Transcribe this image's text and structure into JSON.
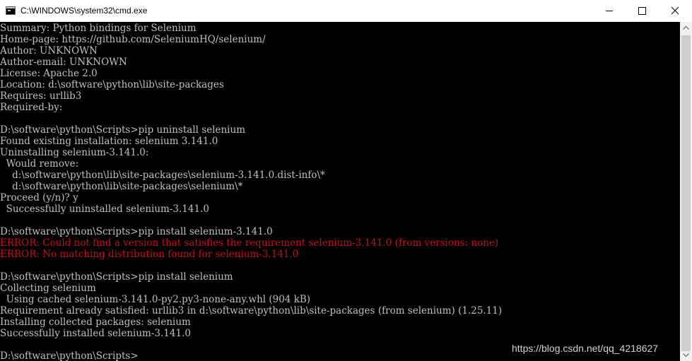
{
  "window": {
    "title": "C:\\WINDOWS\\system32\\cmd.exe",
    "icon": "console-icon",
    "controls": {
      "minimize": "minimize-icon",
      "maximize": "maximize-icon",
      "close": "close-icon"
    }
  },
  "console": {
    "text_color": "#c0c0c0",
    "error_color": "#c50f1f",
    "background": "#000000",
    "lines": [
      {
        "text": "Summary: Python bindings for Selenium",
        "type": "normal"
      },
      {
        "text": "Home-page: https://github.com/SeleniumHQ/selenium/",
        "type": "normal"
      },
      {
        "text": "Author: UNKNOWN",
        "type": "normal"
      },
      {
        "text": "Author-email: UNKNOWN",
        "type": "normal"
      },
      {
        "text": "License: Apache 2.0",
        "type": "normal"
      },
      {
        "text": "Location: d:\\software\\python\\lib\\site-packages",
        "type": "normal"
      },
      {
        "text": "Requires: urllib3",
        "type": "normal"
      },
      {
        "text": "Required-by:",
        "type": "normal"
      },
      {
        "text": "",
        "type": "normal"
      },
      {
        "text": "D:\\software\\python\\Scripts>pip uninstall selenium",
        "type": "normal"
      },
      {
        "text": "Found existing installation: selenium 3.141.0",
        "type": "normal"
      },
      {
        "text": "Uninstalling selenium-3.141.0:",
        "type": "normal"
      },
      {
        "text": "  Would remove:",
        "type": "normal"
      },
      {
        "text": "    d:\\software\\python\\lib\\site-packages\\selenium-3.141.0.dist-info\\*",
        "type": "normal"
      },
      {
        "text": "    d:\\software\\python\\lib\\site-packages\\selenium\\*",
        "type": "normal"
      },
      {
        "text": "Proceed (y/n)? y",
        "type": "normal"
      },
      {
        "text": "  Successfully uninstalled selenium-3.141.0",
        "type": "normal"
      },
      {
        "text": "",
        "type": "normal"
      },
      {
        "text": "D:\\software\\python\\Scripts>pip install selenium-3.141.0",
        "type": "normal"
      },
      {
        "text": "ERROR: Could not find a version that satisfies the requirement selenium-3.141.0 (from versions: none)",
        "type": "error"
      },
      {
        "text": "ERROR: No matching distribution found for selenium-3.141.0",
        "type": "error"
      },
      {
        "text": "",
        "type": "normal"
      },
      {
        "text": "D:\\software\\python\\Scripts>pip install selenium",
        "type": "normal"
      },
      {
        "text": "Collecting selenium",
        "type": "normal"
      },
      {
        "text": "  Using cached selenium-3.141.0-py2.py3-none-any.whl (904 kB)",
        "type": "normal"
      },
      {
        "text": "Requirement already satisfied: urllib3 in d:\\software\\python\\lib\\site-packages (from selenium) (1.25.11)",
        "type": "normal"
      },
      {
        "text": "Installing collected packages: selenium",
        "type": "normal"
      },
      {
        "text": "Successfully installed selenium-3.141.0",
        "type": "normal"
      },
      {
        "text": "",
        "type": "normal"
      },
      {
        "text": "D:\\software\\python\\Scripts>",
        "type": "normal"
      }
    ]
  },
  "scrollbar": {
    "up_icon": "scroll-up-arrow-icon",
    "down_icon": "scroll-down-arrow-icon"
  },
  "watermark": {
    "text": "https://blog.csdn.net/qq_4218627"
  }
}
